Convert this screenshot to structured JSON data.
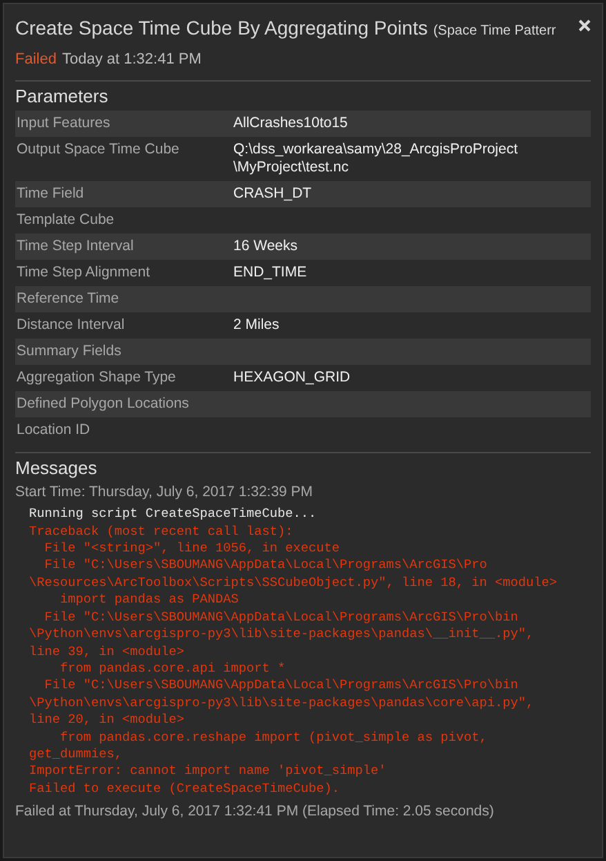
{
  "header": {
    "title": "Create Space Time Cube By Aggregating Points",
    "subtitle": "(Space Time Patterr",
    "status": {
      "label": "Failed",
      "kind": "failed"
    },
    "time": "Today at 1:32:41 PM"
  },
  "parameters": {
    "heading": "Parameters",
    "rows": [
      {
        "label": "Input Features",
        "value": "AllCrashes10to15"
      },
      {
        "label": "Output Space Time Cube",
        "value": "Q:\\dss_workarea\\samy\\28_ArcgisProProject\n\\MyProject\\test.nc"
      },
      {
        "label": "Time Field",
        "value": "CRASH_DT"
      },
      {
        "label": "Template Cube"
      },
      {
        "label": "Time Step Interval",
        "value": "16 Weeks"
      },
      {
        "label": "Time Step Alignment",
        "value": "END_TIME"
      },
      {
        "label": "Reference Time"
      },
      {
        "label": "Distance Interval",
        "value": "2 Miles"
      },
      {
        "label": "Summary Fields"
      },
      {
        "label": "Aggregation Shape Type",
        "value": "HEXAGON_GRID"
      },
      {
        "label": "Defined Polygon Locations"
      },
      {
        "label": "Location ID"
      }
    ]
  },
  "messages": {
    "heading": "Messages",
    "start": "Start Time: Thursday, July 6, 2017 1:32:39 PM",
    "lines": [
      {
        "kind": "info",
        "text": "Running script CreateSpaceTimeCube..."
      },
      {
        "kind": "error",
        "text": "Traceback (most recent call last):\n  File \"<string>\", line 1056, in execute\n  File \"C:\\Users\\SBOUMANG\\AppData\\Local\\Programs\\ArcGIS\\Pro\n\\Resources\\ArcToolbox\\Scripts\\SSCubeObject.py\", line 18, in <module>\n    import pandas as PANDAS\n  File \"C:\\Users\\SBOUMANG\\AppData\\Local\\Programs\\ArcGIS\\Pro\\bin\n\\Python\\envs\\arcgispro-py3\\lib\\site-packages\\pandas\\__init__.py\",\nline 39, in <module>\n    from pandas.core.api import *\n  File \"C:\\Users\\SBOUMANG\\AppData\\Local\\Programs\\ArcGIS\\Pro\\bin\n\\Python\\envs\\arcgispro-py3\\lib\\site-packages\\pandas\\core\\api.py\",\nline 20, in <module>\n    from pandas.core.reshape import (pivot_simple as pivot,\nget_dummies,\nImportError: cannot import name 'pivot_simple'"
      },
      {
        "kind": "error",
        "text": "Failed to execute (CreateSpaceTimeCube)."
      }
    ],
    "end": "Failed at Thursday, July 6, 2017 1:32:41 PM (Elapsed Time: 2.05 seconds)"
  }
}
